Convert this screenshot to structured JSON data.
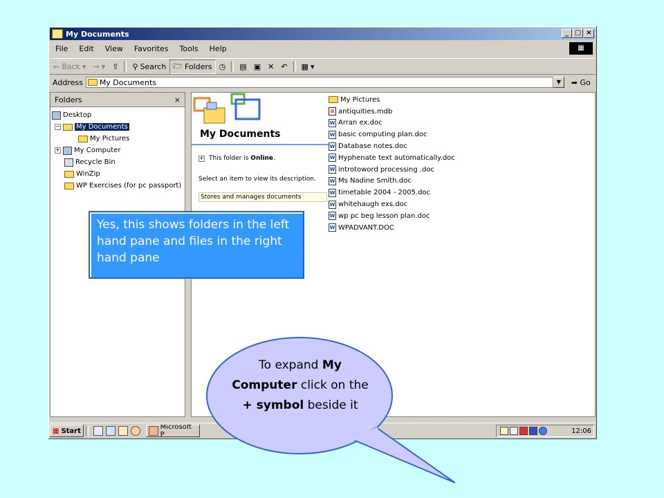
{
  "window": {
    "title": "My Documents",
    "controls": [
      "_",
      "□",
      "×"
    ]
  },
  "menu": [
    "File",
    "Edit",
    "View",
    "Favorites",
    "Tools",
    "Help"
  ],
  "toolbar": {
    "back": "Back",
    "search": "Search",
    "folders": "Folders"
  },
  "address": {
    "label": "Address",
    "value": "My Documents",
    "go": "Go"
  },
  "folders_pane": {
    "title": "Folders",
    "close": "×",
    "tree": [
      {
        "label": "Desktop",
        "expander": "",
        "selected": false
      },
      {
        "label": "My Documents",
        "expander": "−",
        "selected": true
      },
      {
        "label": "My Pictures",
        "expander": "",
        "selected": false
      },
      {
        "label": "My Computer",
        "expander": "+",
        "selected": false
      },
      {
        "label": "Recycle Bin",
        "expander": "",
        "selected": false
      },
      {
        "label": "WinZip",
        "expander": "",
        "selected": false
      },
      {
        "label": "WP Exercises (for pc passport)",
        "expander": "",
        "selected": false
      }
    ]
  },
  "info_pane": {
    "title": "My Documents",
    "online_prefix": "This folder is ",
    "online_value": "Online",
    "online_suffix": ".",
    "expand": "+",
    "select_hint": "Select an item to view its description.",
    "stores": "Stores and manages documents"
  },
  "files": [
    {
      "name": "My Pictures",
      "type": "folder"
    },
    {
      "name": "antiquities.mdb",
      "type": "mdb"
    },
    {
      "name": "Arran ex.doc",
      "type": "doc"
    },
    {
      "name": "basic computing plan.doc",
      "type": "doc"
    },
    {
      "name": "Database notes.doc",
      "type": "doc"
    },
    {
      "name": "Hyphenate text automatically.doc",
      "type": "doc"
    },
    {
      "name": "introtoword processing .doc",
      "type": "doc"
    },
    {
      "name": "Ms Nadine Smith.doc",
      "type": "doc"
    },
    {
      "name": "timetable 2004 - 2005.doc",
      "type": "doc"
    },
    {
      "name": "whitehaugh exs.doc",
      "type": "doc"
    },
    {
      "name": "wp pc beg lesson plan.doc",
      "type": "doc"
    },
    {
      "name": "WPADVANT.DOC",
      "type": "doc"
    }
  ],
  "taskbar": {
    "start": "Start",
    "task": "Microsoft P",
    "clock": "12:06"
  },
  "callout1": {
    "text": "Yes, this shows folders in the left hand pane and files in the right hand pane"
  },
  "callout2": {
    "t1": "To expand ",
    "b1": "My Computer",
    "t2": " click on the ",
    "b2": "+ symbol",
    "t3": " beside it"
  },
  "colors": {
    "background": "#ccffff",
    "callout1": "#3399ff",
    "callout2": "#ccccff",
    "titlebar": "#0a246a"
  }
}
